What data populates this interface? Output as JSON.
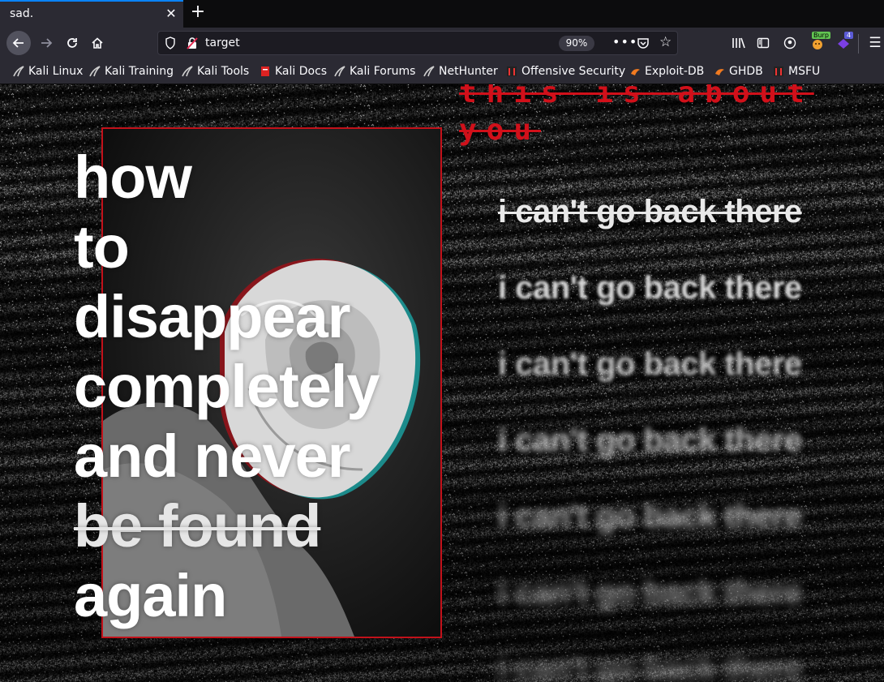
{
  "tab": {
    "title": "sad.",
    "close_glyph": "✕",
    "new_tab_glyph": "+"
  },
  "navbar": {
    "url": "target",
    "zoom": "90%",
    "icons": [
      "back-arrow-icon",
      "forward-arrow-icon",
      "reload-icon",
      "home-icon",
      "shield-icon",
      "insecure-connection-icon",
      "page-actions-icon",
      "pocket-icon",
      "star-icon",
      "library-icon",
      "sidebar-icon",
      "account-icon",
      "burp-extension-icon",
      "extension-icon",
      "hamburger-menu-icon"
    ],
    "burp_badge": "Burp",
    "ext_count": "4"
  },
  "bookmarks": [
    {
      "label": "Kali Linux",
      "icon": "kali-dragon-icon"
    },
    {
      "label": "Kali Training",
      "icon": "kali-dragon-icon"
    },
    {
      "label": "Kali Tools",
      "icon": "kali-dragon-icon"
    },
    {
      "label": "Kali Docs",
      "icon": "kali-docs-icon"
    },
    {
      "label": "Kali Forums",
      "icon": "kali-dragon-icon"
    },
    {
      "label": "NetHunter",
      "icon": "kali-dragon-icon"
    },
    {
      "label": "Offensive Security",
      "icon": "offsec-icon"
    },
    {
      "label": "Exploit-DB",
      "icon": "exploit-db-icon"
    },
    {
      "label": "GHDB",
      "icon": "exploit-db-icon"
    },
    {
      "label": "MSFU",
      "icon": "offsec-icon"
    }
  ],
  "page": {
    "heading_lines": [
      "how",
      "to",
      "disappear",
      "completely",
      "and never",
      "be found",
      "again"
    ],
    "about_text": "this is about you",
    "cant_text": "i can't go back there",
    "accent_color": "#c2111a",
    "text_color": "#ffffff"
  }
}
